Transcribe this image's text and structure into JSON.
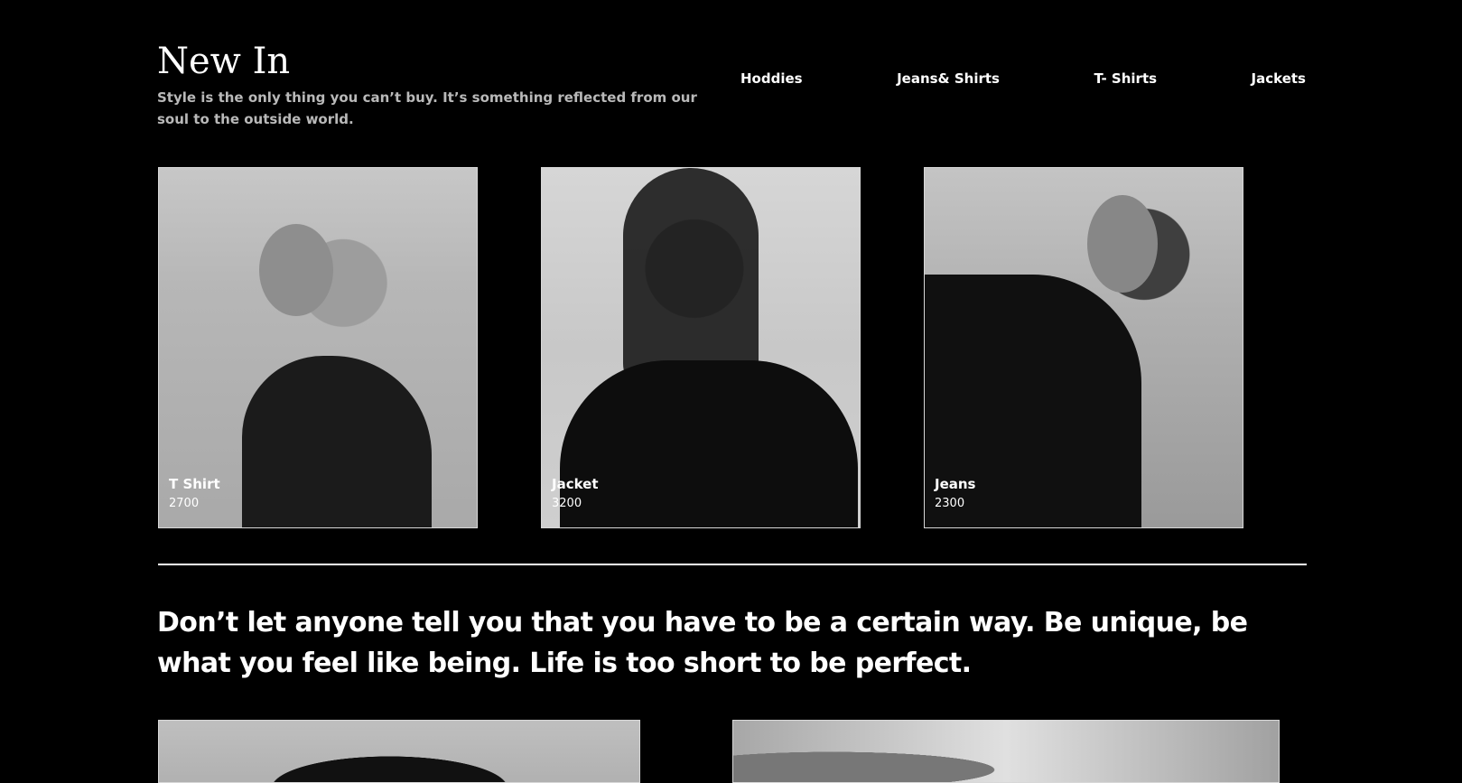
{
  "top_strip": {
    "text": ""
  },
  "header": {
    "title": "New In",
    "subtitle": "Style is the only thing you can’t buy. It’s something reflected from our soul to the outside world."
  },
  "categories": [
    {
      "label": "Hoddies"
    },
    {
      "label": "Jeans& Shirts"
    },
    {
      "label": "T- Shirts"
    },
    {
      "label": "Jackets"
    }
  ],
  "products": [
    {
      "name": "T Shirt",
      "price": "2700"
    },
    {
      "name": "Jacket",
      "price": "3200"
    },
    {
      "name": "Jeans",
      "price": "2300"
    }
  ],
  "quote": "Don’t let anyone tell you that you have to be a certain way. Be unique, be what you feel like being. Life is too short to be perfect.",
  "colors": {
    "background": "#000000",
    "text": "#FFFFFF",
    "muted_text": "#B9B9B9",
    "divider": "#FFFFFF"
  }
}
